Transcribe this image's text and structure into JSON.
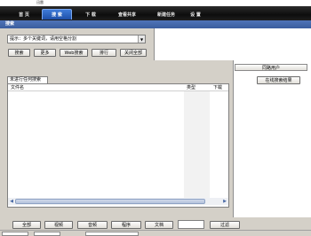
{
  "window": {
    "title": "迅雷"
  },
  "toolbar": {
    "tabs": [
      {
        "label": "首 页"
      },
      {
        "label": "搜 索"
      },
      {
        "label": "下 载"
      },
      {
        "label": "查看共享"
      },
      {
        "label": "新建任务"
      },
      {
        "label": "设 置"
      }
    ],
    "selected_index": 1
  },
  "search": {
    "section_title": "搜索",
    "input_value": "提示：多个关键词，请用空格分割",
    "buttons": {
      "search": "搜索",
      "more": "更多",
      "web_search": "Web搜索",
      "rank": "排行",
      "close_all": "关闭全部"
    }
  },
  "results": {
    "tab_label": "未进行任何搜索",
    "columns": {
      "filename": "文件名",
      "type": "类型",
      "download": "下载"
    }
  },
  "right_panel": {
    "header": "同路用户",
    "button": "在线搜索结果"
  },
  "categories": [
    {
      "label": "全部"
    },
    {
      "label": "视频"
    },
    {
      "label": "音频"
    },
    {
      "label": "程序"
    },
    {
      "label": "文档"
    }
  ],
  "filter_label": "过滤",
  "colors": {
    "toolbar_bg": "#111111",
    "selected_tab": "#2a64c5",
    "section_band": "#4a6fb0",
    "window_bg": "#d4d0c8"
  }
}
